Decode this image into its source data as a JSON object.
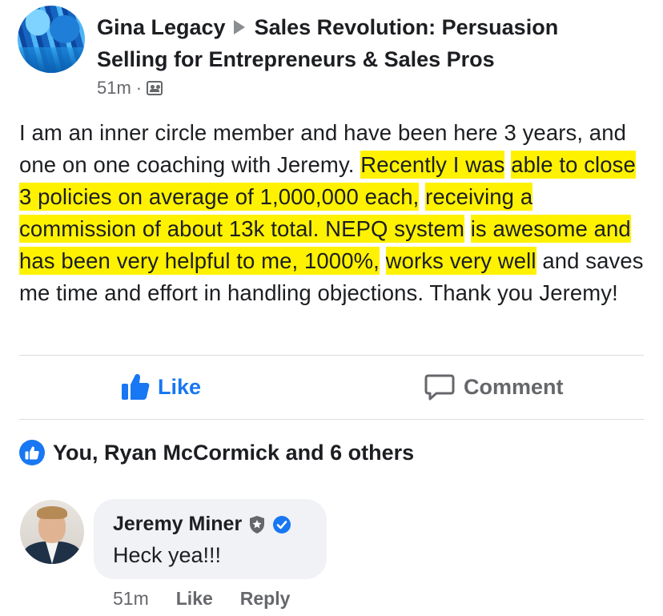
{
  "post": {
    "author": "Gina Legacy",
    "group_line1": "Sales Revolution: Persuasion",
    "group_line2": "Selling for Entrepreneurs & Sales Pros",
    "time": "51m",
    "separator": "·",
    "text": {
      "before_highlight": "I am an inner circle member and have been here 3 years, and one on one coaching with Jeremy. ",
      "highlight_1": "Recently I was",
      "highlight_2": "able to close 3 policies on average of 1,000,000 each,",
      "highlight_3": "receiving a commission of  about 13k total. NEPQ system",
      "highlight_4": "is awesome and has been very helpful to me, 1000%,",
      "highlight_5": "works very well",
      "after_highlight": " and saves me time and effort in handling objections.  Thank you Jeremy!"
    },
    "highlight_color": "#fff200"
  },
  "actions": {
    "like_label": "Like",
    "comment_label": "Comment",
    "like_color": "#1877f2"
  },
  "reactions": {
    "summary": "You, Ryan McCormick and 6 others"
  },
  "comment": {
    "author": "Jeremy Miner",
    "text": "Heck yea!!!",
    "time": "51m",
    "like_label": "Like",
    "reply_label": "Reply"
  }
}
